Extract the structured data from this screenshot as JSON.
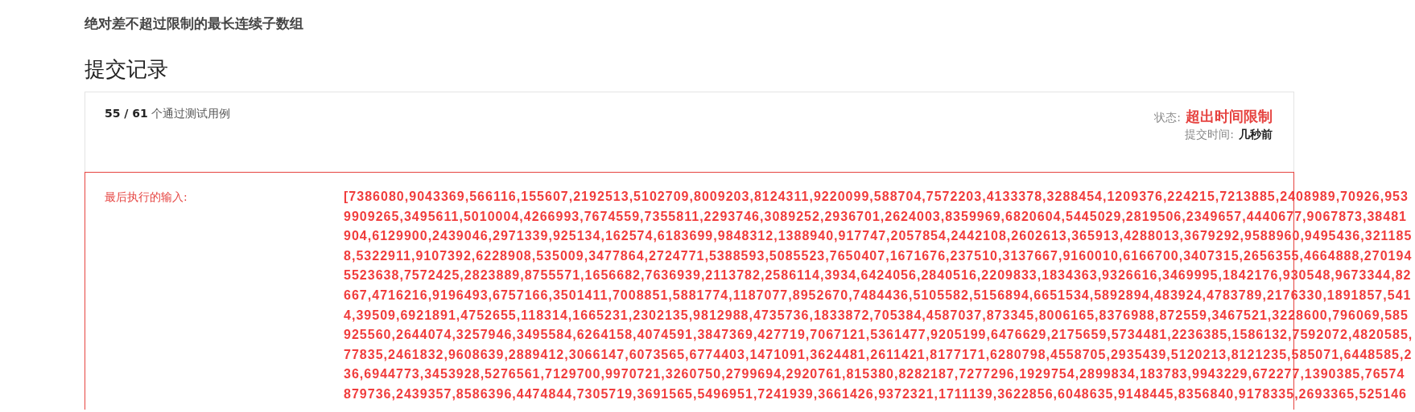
{
  "problem_title": "绝对差不超过限制的最长连续子数组",
  "section_title": "提交记录",
  "result": {
    "summary": "**55 / 61** 个通过测试用例",
    "status_label": "状态:",
    "status": "超出时间限制",
    "time_label": "提交时间:",
    "time": "几秒前"
  },
  "last_input": {
    "label": "最后执行的输入:",
    "lines": [
      "[7386080,9043369,566116,155607,2192513,5102709,8009203,8124311,9220099,588704,7572203,4133378,3288454,1209376,224215,7213885,2408989,70926,953",
      "9909265,3495611,5010004,4266993,7674559,7355811,2293746,3089252,2936701,2624003,8359969,6820604,5445029,2819506,2349657,4440677,9067873,38481",
      "904,6129900,2439046,2971339,925134,162574,6183699,9848312,1388940,917747,2057854,2442108,2602613,365913,4288013,3679292,9588960,9495436,321185",
      "8,5322911,9107392,6228908,535009,3477864,2724771,5388593,5085523,7650407,1671676,237510,3137667,9160010,6166700,3407315,2656355,4664888,270194",
      "5523638,7572425,2823889,8755571,1656682,7636939,2113782,2586114,3934,6424056,2840516,2209833,1834363,9326616,3469995,1842176,930548,9673344,82",
      "667,4716216,9196493,6757166,3501411,7008851,5881774,1187077,8952670,7484436,5105582,5156894,6651534,5892894,483924,4783789,2176330,1891857,541",
      "4,39509,6921891,4752655,118314,1665231,2302135,9812988,4735736,1833872,705384,4587037,873345,8006165,8376988,872559,3467521,3228600,796069,585",
      "925560,2644074,3257946,3495584,6264158,4074591,3847369,427719,7067121,5361477,9205199,6476629,2175659,5734481,2236385,1586132,7592072,4820585,",
      "77835,2461832,9608639,2889412,3066147,6073565,6774403,1471091,3624481,2611421,8177171,6280798,4558705,2935439,5120213,8121235,585071,6448585,2",
      "36,6944773,3453928,5276561,7129700,9970721,3260750,2799694,2920761,815380,8282187,7277296,1929754,2899834,183783,9943229,672277,1390385,76574",
      "879736,2439357,8586396,4474844,7305719,3691565,5496951,7241939,3661426,9372321,1711139,3622856,6048635,9148445,8356840,9178335,2693365,525146"
    ]
  }
}
